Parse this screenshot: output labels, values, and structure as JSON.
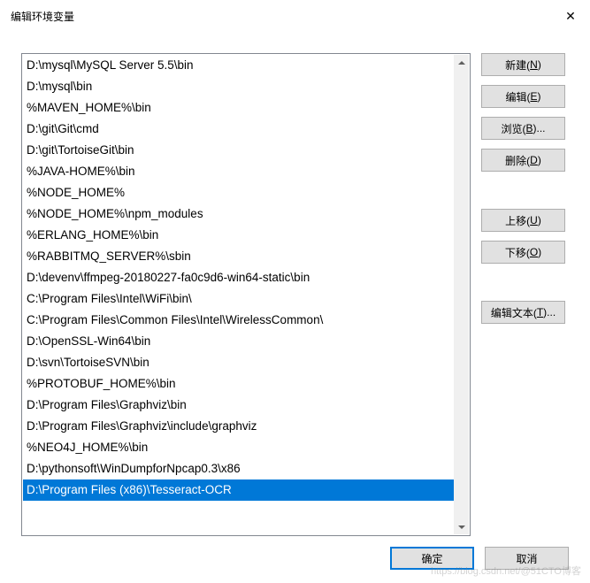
{
  "title": "编辑环境变量",
  "close": "✕",
  "list": {
    "items": [
      "D:\\mysql\\MySQL Server 5.5\\bin",
      "D:\\mysql\\bin",
      "%MAVEN_HOME%\\bin",
      "D:\\git\\Git\\cmd",
      "D:\\git\\TortoiseGit\\bin",
      "%JAVA-HOME%\\bin",
      "%NODE_HOME%",
      "%NODE_HOME%\\npm_modules",
      "%ERLANG_HOME%\\bin",
      "%RABBITMQ_SERVER%\\sbin",
      "D:\\devenv\\ffmpeg-20180227-fa0c9d6-win64-static\\bin",
      "C:\\Program Files\\Intel\\WiFi\\bin\\",
      "C:\\Program Files\\Common Files\\Intel\\WirelessCommon\\",
      "D:\\OpenSSL-Win64\\bin",
      "D:\\svn\\TortoiseSVN\\bin",
      "%PROTOBUF_HOME%\\bin",
      "D:\\Program Files\\Graphviz\\bin",
      "D:\\Program Files\\Graphviz\\include\\graphviz",
      "%NEO4J_HOME%\\bin",
      "D:\\pythonsoft\\WinDumpforNpcap0.3\\x86",
      "D:\\Program Files (x86)\\Tesseract-OCR"
    ],
    "selectedIndex": 20
  },
  "buttons": {
    "new": {
      "label": "新建(",
      "key": "N",
      "tail": ")"
    },
    "edit": {
      "label": "编辑(",
      "key": "E",
      "tail": ")"
    },
    "browse": {
      "label": "浏览(",
      "key": "B",
      "tail": ")..."
    },
    "delete": {
      "label": "删除(",
      "key": "D",
      "tail": ")"
    },
    "up": {
      "label": "上移(",
      "key": "U",
      "tail": ")"
    },
    "down": {
      "label": "下移(",
      "key": "O",
      "tail": ")"
    },
    "editText": {
      "label": "编辑文本(",
      "key": "T",
      "tail": ")..."
    },
    "ok": "确定",
    "cancel": "取消"
  },
  "watermark": "https://blog.csdn.net/@51CTO博客"
}
